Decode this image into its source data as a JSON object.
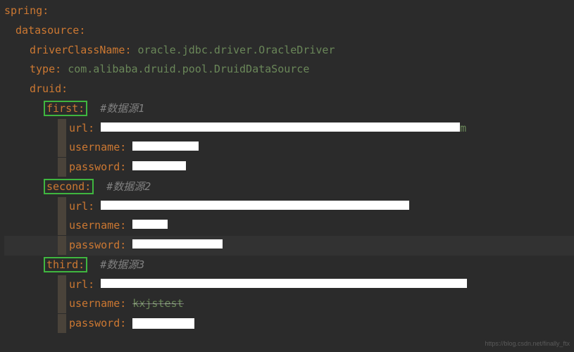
{
  "yaml": {
    "root": {
      "key": "spring",
      "colon": ":"
    },
    "datasource": {
      "key": "datasource",
      "colon": ":"
    },
    "driver": {
      "key": "driverClassName",
      "colon": ": ",
      "value": "oracle.jdbc.driver.OracleDriver"
    },
    "type": {
      "key": "type",
      "colon": ": ",
      "value": "com.alibaba.druid.pool.DruidDataSource"
    },
    "druid": {
      "key": "druid",
      "colon": ":"
    },
    "first": {
      "key": "first",
      "colon": ":",
      "comment": "#数据源1"
    },
    "second": {
      "key": "second",
      "colon": ":",
      "comment": "#数据源2"
    },
    "third": {
      "key": "third",
      "colon": ":",
      "comment": "#数据源3"
    },
    "url": {
      "key": "url",
      "colon": ": "
    },
    "username": {
      "key": "username",
      "colon": ": "
    },
    "password": {
      "key": "password",
      "colon": ": "
    },
    "url_tail": "m",
    "username3_visible": "kxjstest"
  },
  "watermark": "https://blog.csdn.net/finally_ftx"
}
